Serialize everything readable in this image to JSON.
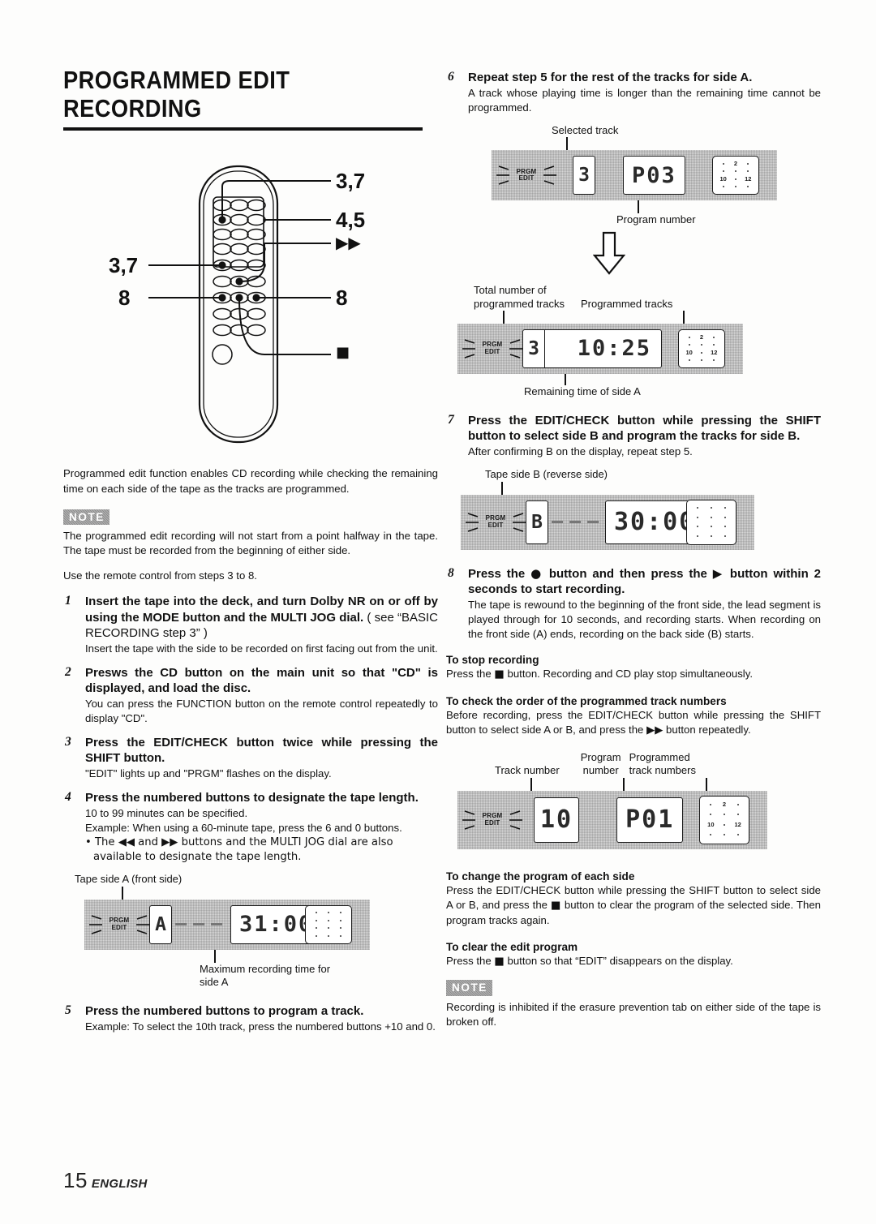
{
  "page": {
    "title_line1": "PROGRAMMED EDIT",
    "title_line2": "RECORDING",
    "footer_number": "15",
    "footer_language": "ENGLISH"
  },
  "remote_callouts": {
    "top_right": "3,7",
    "second_right": "4,5",
    "left_upper": "3,7",
    "left_lower": "8",
    "ff_symbol": "▶▶",
    "right_lower": "8",
    "stop_symbol": "■"
  },
  "intro": {
    "paragraph": "Programmed edit function enables CD recording while checking the remaining time on each side of the tape as the tracks are programmed.",
    "note_label": "NOTE",
    "note_text": "The programmed edit recording will not start from a point halfway in the tape. The tape must be recorded from the beginning of either side.",
    "remote_hint": "Use the remote control from steps 3 to 8."
  },
  "steps": [
    {
      "num": "1",
      "head_bold": "Insert the tape into the deck, and turn Dolby NR on or off by using the MODE button and the MULTI JOG dial.",
      "head_regular": " ( see “BASIC RECORDING step 3” )",
      "body": "Insert the tape with the side to be recorded on first facing out from the unit."
    },
    {
      "num": "2",
      "head_bold": "Presws the CD button on the main unit so that \"CD\" is displayed, and load the disc.",
      "head_regular": "",
      "body": "You can press the FUNCTION button on the remote control repeatedly to display \"CD\"."
    },
    {
      "num": "3",
      "head_bold": "Press the EDIT/CHECK button twice while pressing the SHIFT button.",
      "head_regular": "",
      "body": "\"EDIT\" lights up and \"PRGM\" flashes on the display."
    },
    {
      "num": "4",
      "head_bold": "Press the numbered buttons to designate the tape length.",
      "head_regular": "",
      "body": "10 to 99 minutes can be specified.",
      "body2": "Example: When using a 60-minute tape, press the 6 and 0 buttons.",
      "bullet": "• The ◀◀ and ▶▶ buttons and the MULTI JOG dial are also available to designate the tape length."
    },
    {
      "num": "5",
      "head_bold": "Press the numbered buttons to program a track.",
      "head_regular": "",
      "body": "Example: To select the 10th track, press  the numbered buttons +10 and 0."
    },
    {
      "num": "6",
      "head_bold": "Repeat step 5 for the rest of the tracks for side A.",
      "head_regular": "",
      "body": "A track whose playing time is longer than the remaining time cannot be programmed."
    },
    {
      "num": "7",
      "head_bold": "Press the EDIT/CHECK button while pressing the SHIFT button to select side B and program the tracks for side B.",
      "head_regular": "",
      "body": "After confirming B on the display, repeat step 5."
    },
    {
      "num": "8",
      "head_bold_pre": "Press the ",
      "head_symbol1": "●",
      "head_bold_mid": " button and then press the ",
      "head_symbol2": "▶",
      "head_bold_post": " button within 2 seconds to start recording.",
      "body": "The tape is rewound to the beginning of the front side, the lead segment is played through for 10 seconds, and recording starts.  When recording on the front side (A) ends, recording on the back side (B) starts."
    }
  ],
  "displays": {
    "side_a": {
      "top_label": "Tape side A (front side)",
      "prgm": "PRGM",
      "edit": "EDIT",
      "side_char": "A",
      "main": "31:00",
      "bottom_label_line1": "Maximum recording time for",
      "bottom_label_line2": "side A",
      "matrix": [
        "",
        "",
        "",
        "",
        "",
        "",
        "",
        "",
        "",
        "",
        "",
        ""
      ]
    },
    "selected_track": {
      "top_label": "Selected track",
      "prgm": "PRGM",
      "edit": "EDIT",
      "side_char": "3",
      "main": "P03",
      "bottom_label": "Program number",
      "matrix": [
        "",
        "2",
        "",
        "10",
        "",
        "12",
        "",
        "",
        "",
        "",
        "",
        ""
      ]
    },
    "totals": {
      "label_total_line1": "Total number of",
      "label_total_line2": "programmed tracks",
      "label_tracks": "Programmed tracks",
      "prgm": "PRGM",
      "edit": "EDIT",
      "side_char": "3",
      "main": "10:25",
      "bottom_label": "Remaining time of side A",
      "matrix": [
        "",
        "2",
        "",
        "10",
        "",
        "12",
        "",
        "",
        "",
        "",
        "",
        ""
      ]
    },
    "side_b": {
      "top_label": "Tape side B (reverse side)",
      "prgm": "PRGM",
      "edit": "EDIT",
      "side_char": "B",
      "main": "30:00",
      "matrix": [
        "",
        "",
        "",
        "",
        "",
        "",
        "",
        "",
        "",
        "",
        "",
        ""
      ]
    },
    "check_order": {
      "label_track": "Track number",
      "label_program_line1": "Program",
      "label_program_line2": "number",
      "label_programmed_line1": "Programmed",
      "label_programmed_line2": "track numbers",
      "prgm": "PRGM",
      "edit": "EDIT",
      "side_char": "10",
      "main": "P01",
      "matrix": [
        "",
        "2",
        "",
        "10",
        "",
        "12",
        "",
        "",
        "",
        "",
        "",
        ""
      ]
    }
  },
  "tips": {
    "stop_head": "To stop recording",
    "stop_body_pre": "Press the ",
    "stop_symbol": "■",
    "stop_body_post": " button. Recording and CD play stop simultaneously.",
    "check_head": "To check the order of the programmed track numbers",
    "check_body_pre": "Before recording, press the EDIT/CHECK button while pressing the SHIFT button to select side A or B, and press the ",
    "check_symbol": "▶▶",
    "check_body_post": " button repeatedly.",
    "change_head": "To change the program of each side",
    "change_body_pre": "Press the EDIT/CHECK button while pressing the SHIFT button to select side A or B, and press the ",
    "change_symbol": "■",
    "change_body_post": " button to clear the program of the selected side. Then program tracks again.",
    "clear_head": "To clear the edit program",
    "clear_body_pre": "Press the ",
    "clear_symbol": "■",
    "clear_body_post": " button so that “EDIT” disappears on the display.",
    "note_label": "NOTE",
    "note_text": "Recording is inhibited if the erasure prevention tab on either side of the tape is broken off."
  }
}
